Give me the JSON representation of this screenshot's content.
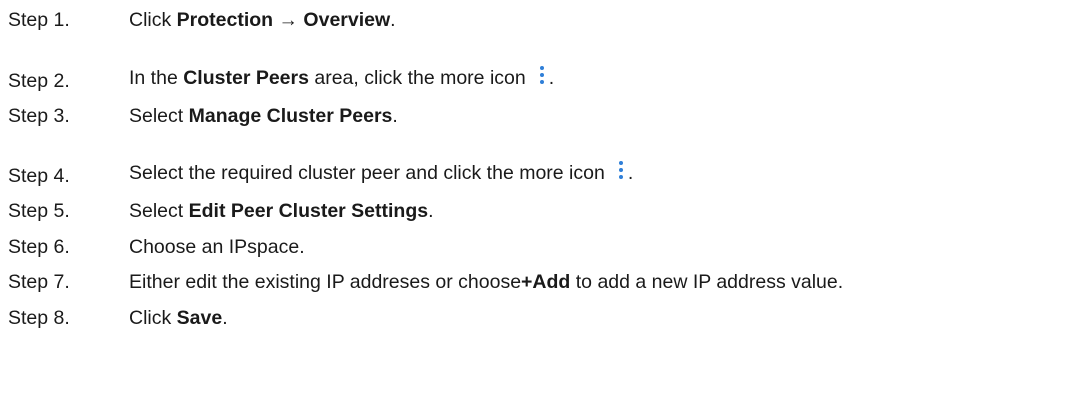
{
  "steps": [
    {
      "number": "Step 1.",
      "parts": [
        {
          "text": "Click "
        },
        {
          "text": "Protection → Overview",
          "bold": true
        },
        {
          "text": "."
        }
      ]
    },
    {
      "number": "Step 2.",
      "parts": [
        {
          "text": "In the "
        },
        {
          "text": "Cluster Peers",
          "bold": true
        },
        {
          "text": " area, click the more icon"
        },
        {
          "icon": "more-vertical-icon"
        },
        {
          "text": "."
        }
      ]
    },
    {
      "number": "Step 3.",
      "parts": [
        {
          "text": "Select "
        },
        {
          "text": "Manage Cluster Peers",
          "bold": true
        },
        {
          "text": "."
        }
      ]
    },
    {
      "number": "Step 4.",
      "parts": [
        {
          "text": "Select the required cluster peer and click the more icon"
        },
        {
          "icon": "more-vertical-icon"
        },
        {
          "text": "."
        }
      ]
    },
    {
      "number": "Step 5.",
      "parts": [
        {
          "text": "Select "
        },
        {
          "text": "Edit Peer Cluster Settings",
          "bold": true
        },
        {
          "text": "."
        }
      ]
    },
    {
      "number": "Step 6.",
      "parts": [
        {
          "text": "Choose an IPspace."
        }
      ]
    },
    {
      "number": "Step 7.",
      "parts": [
        {
          "text": "Either edit the existing IP addreses or choose"
        },
        {
          "text": "+Add",
          "bold": true
        },
        {
          "text": " to add a new IP address value."
        }
      ]
    },
    {
      "number": "Step 8.",
      "parts": [
        {
          "text": "Click "
        },
        {
          "text": "Save",
          "bold": true
        },
        {
          "text": "."
        }
      ]
    }
  ],
  "colors": {
    "text": "#1a1a1a",
    "icon": "#2f7fd8",
    "background": "#ffffff"
  }
}
